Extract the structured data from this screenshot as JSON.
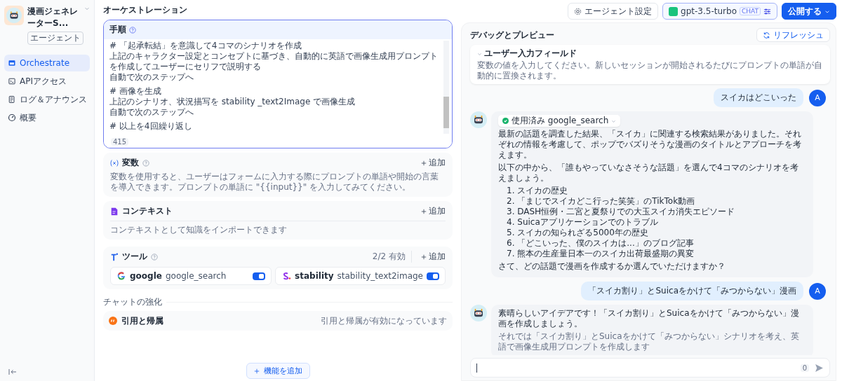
{
  "app": {
    "name": "漫画ジェネレーターS...",
    "badge": "エージェント"
  },
  "sidebar": {
    "items": [
      {
        "label": "Orchestrate",
        "selected": true
      },
      {
        "label": "APIアクセス",
        "selected": false
      },
      {
        "label": "ログ＆アナウンス",
        "selected": false
      },
      {
        "label": "概要",
        "selected": false
      }
    ]
  },
  "orchestration": {
    "title": "オーケストレーション",
    "prompt": {
      "title": "手順",
      "count": "415",
      "sections": [
        {
          "lines": [
            "# 「起承転結」を意識して4コマのシナリオを作成",
            "上記のキャラクター設定とコンセプトに基づき、自動的に英語で画像生成用プロンプトを作成してユーザーにセリフで説明する",
            "自動で次のステップへ"
          ]
        },
        {
          "lines": [
            "# 画像を生成",
            "上記のシナリオ、状況描写を stability _text2Image で画像生成",
            "自動で次のステップへ"
          ]
        },
        {
          "lines": [
            "# 以上を4回繰り返し"
          ]
        }
      ]
    },
    "variables": {
      "title": "変数",
      "add": "追加",
      "description": "変数を使用すると、ユーザーはフォームに入力する際にプロンプトの単語や開始の言葉を導入できます。プロンプトの単語に \"{{input}}\" を入力してみてください。"
    },
    "context": {
      "title": "コンテキスト",
      "add": "追加",
      "description": "コンテキストとして知識をインポートできます"
    },
    "tools": {
      "title": "ツール",
      "status": "2/2 有効",
      "add": "追加",
      "items": [
        {
          "provider": "google",
          "name": "google_search",
          "kind": "google",
          "enabled": true
        },
        {
          "provider": "stability",
          "name": "stability_text2image",
          "kind": "stability",
          "enabled": true
        }
      ]
    },
    "enhancement": {
      "label": "チャットの強化",
      "items": [
        {
          "title": "引用と帰属",
          "status": "引用と帰属が有効になっています"
        }
      ]
    },
    "add_feature": "機能を追加"
  },
  "header": {
    "agent_settings": "エージェント設定",
    "model": {
      "name": "gpt-3.5-turbo",
      "badge": "CHAT"
    },
    "publish": "公開する"
  },
  "debug": {
    "title": "デバッグとプレビュー",
    "refresh": "リフレッシュ",
    "input_fields": {
      "title": "ユーザー入力フィールド",
      "description": "変数の値を入力してください。新しいセッションが開始されるたびにプロンプトの単語が自動的に置換されます。"
    },
    "messages": [
      {
        "kind": "user",
        "avatar": "A",
        "text": "スイカはどこいった"
      },
      {
        "kind": "bot",
        "tool_used": "使用済み google_search",
        "blocks": [
          {
            "kind": "paragraph",
            "text": "最新の話題を調査した結果、「スイカ」に関連する検索結果がありました。それぞれの情報を考慮して、ポップでバズりそうな漫画のタイトルとアプローチを考えます。"
          },
          {
            "kind": "paragraph",
            "text": "以下の中から、「誰もやっていなさそうな話題」を選んで4コマのシナリオを考えましょう。"
          },
          {
            "kind": "list",
            "items": [
              "1. スイカの歴史",
              "2. 「まじでスイカどこ行った笑笑」のTikTok動画",
              "3. DASH恒例・二宮と夏祭りでの大玉スイカ消失エピソード",
              "4. Suicaアプリケーションでのトラブル",
              "5. スイカの知られざる5000年の歴史",
              "6. 「どこいった、僕のスイカは...」のブログ記事",
              "7. 熊本の生産量日本一のスイカ出荷最盛期の異変"
            ]
          },
          {
            "kind": "paragraph",
            "text": "さて、どの話題で漫画を作成するか選んでいただけますか？"
          }
        ]
      },
      {
        "kind": "user",
        "avatar": "A",
        "text": "「スイカ割り」とSuicaをかけて「みつからない」漫画"
      },
      {
        "kind": "bot",
        "blocks": [
          {
            "kind": "paragraph",
            "text": "素晴らしいアイデアです！「スイカ割り」とSuicaをかけて「みつからない」漫画を作成しましょう。"
          },
          {
            "kind": "faded",
            "text": "それでは「スイカ割り」とSuicaをかけて「みつからない」シナリオを考え、英語で画像生成用プロンプトを作成します"
          }
        ]
      }
    ],
    "composer": {
      "count": "0"
    }
  }
}
